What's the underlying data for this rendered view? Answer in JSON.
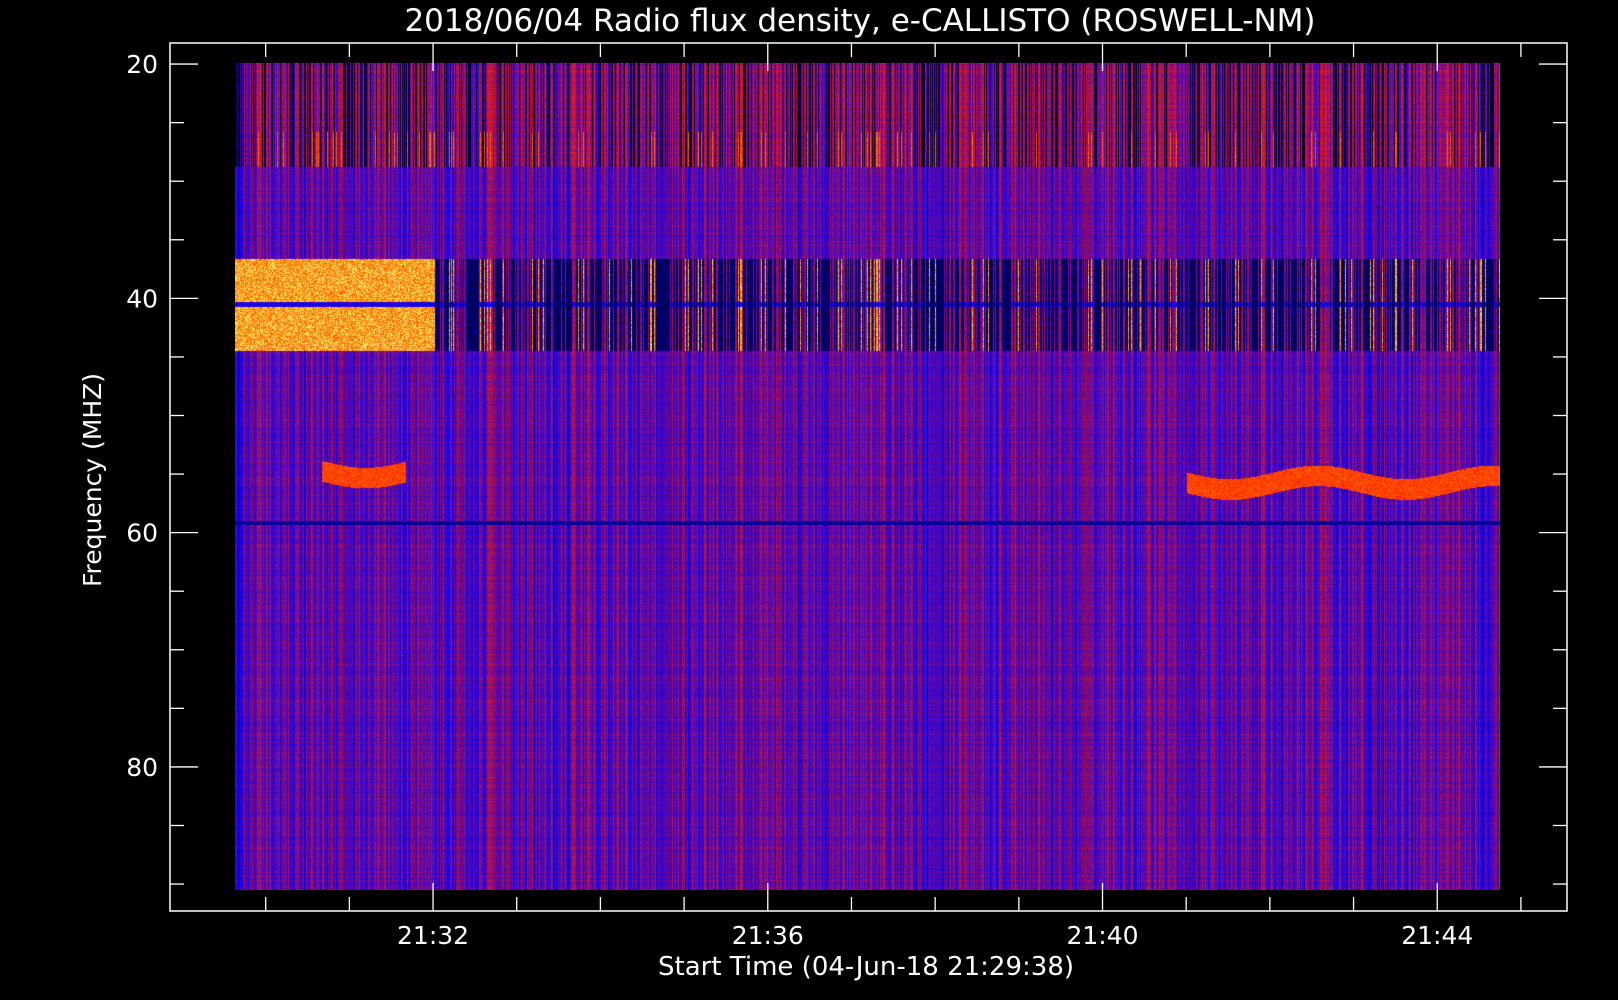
{
  "chart_data": {
    "type": "heatmap",
    "title": "2018/06/04  Radio flux density, e-CALLISTO (ROSWELL-NM)",
    "xlabel": "Start Time (04-Jun-18 21:29:38)",
    "ylabel": "Frequency (MHZ)",
    "x_axis": {
      "unit": "time",
      "range_minutes": [
        21.5,
        21.75
      ],
      "data_start": "21:29:38",
      "data_end": "21:44:45",
      "major_ticks": [
        {
          "label": "21:32",
          "value": "21:32"
        },
        {
          "label": "21:36",
          "value": "21:36"
        },
        {
          "label": "21:40",
          "value": "21:40"
        },
        {
          "label": "21:44",
          "value": "21:44"
        }
      ],
      "minor_tick_step_minutes": 1
    },
    "y_axis": {
      "unit": "MHz",
      "inverted": true,
      "range": [
        18.2,
        92.3
      ],
      "data_range": [
        20,
        92
      ],
      "major_ticks": [
        20,
        40,
        60,
        80
      ],
      "minor_tick_step": 5
    },
    "colormap": [
      "#000000",
      "#0000ff",
      "#6a0a9a",
      "#ff2000",
      "#ff8000",
      "#ffe060",
      "#c8ff80"
    ],
    "features": [
      {
        "kind": "interference_band",
        "freq_range": [
          20,
          29
        ],
        "intensity": "medium"
      },
      {
        "kind": "interference_band",
        "freq_range": [
          37,
          45
        ],
        "intensity": "high"
      },
      {
        "kind": "emission_lane",
        "freq": 55.5,
        "time_range": [
          "21:30:40",
          "21:31:40"
        ],
        "intensity": "medium"
      },
      {
        "kind": "emission_lane",
        "freq": 56.5,
        "time_range": [
          "21:41:00",
          "21:44:45"
        ],
        "intensity": "medium"
      },
      {
        "kind": "horizontal_line",
        "freq": 60,
        "intensity": "low"
      }
    ]
  }
}
